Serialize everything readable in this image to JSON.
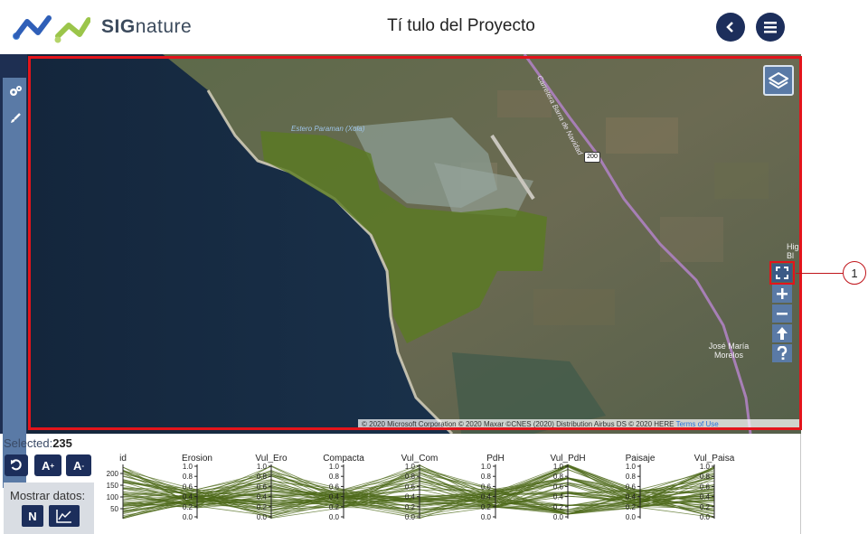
{
  "header": {
    "brand_bold": "SIG",
    "brand_rest": "nature",
    "title": "Tí tulo del Proyecto"
  },
  "left_toolbar": {
    "icons": [
      "gears-icon",
      "brush-icon"
    ]
  },
  "map": {
    "label_estero": "Estero Paraman (Xola)",
    "label_road": "Carretera Barra de Navidad",
    "road_shield": "200",
    "label_town": "José María Morelos",
    "label_edge": "Hig Bl",
    "attribution": "© 2020 Microsoft Corporation © 2020 Maxar ©CNES (2020) Distribution Airbus DS © 2020 HERE",
    "terms_link": "Terms of Use",
    "controls": [
      "fullscreen-icon",
      "zoom-in-icon",
      "zoom-out-icon",
      "north-arrow-icon",
      "help-icon"
    ]
  },
  "callout": {
    "number": "1"
  },
  "bottom": {
    "selected_label": "Selected:",
    "selected_count": "235",
    "font_plus": "A",
    "font_minus": "A",
    "show_data_label": "Mostrar datos:",
    "n_button": "N"
  },
  "chart_data": {
    "type": "parallel-coordinates",
    "axes": [
      "id",
      "Erosion",
      "Vul_Ero",
      "Compacta",
      "Vul_Com",
      "PdH",
      "Vul_PdH",
      "Paisaje",
      "Vul_Paisa"
    ],
    "id_ticks": [
      "200",
      "150",
      "100",
      "50"
    ],
    "unit_ticks": [
      "1.0",
      "0.8",
      "0.6",
      "0.4",
      "0.2",
      "0.0"
    ],
    "line_color": "#4d6a1a"
  },
  "colors": {
    "navy": "#1c2e5b",
    "accent_blue": "#5a7aa6",
    "highlight_red": "#e3141b",
    "polygon_green": "#5a7a22"
  }
}
